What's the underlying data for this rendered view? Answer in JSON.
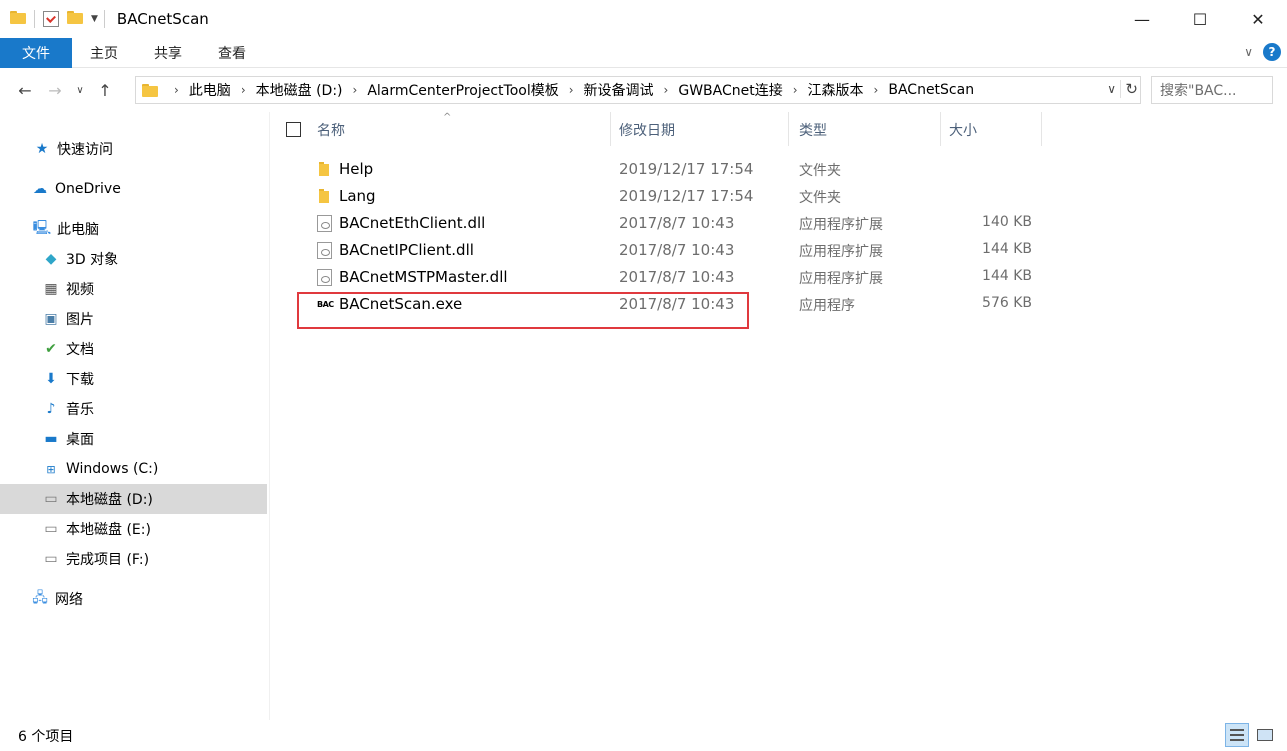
{
  "window": {
    "title": "BACnetScan",
    "controls": {
      "minimize": "—",
      "maximize": "☐",
      "close": "✕"
    }
  },
  "ribbon": {
    "tabs": [
      {
        "label": "文件",
        "active": true
      },
      {
        "label": "主页"
      },
      {
        "label": "共享"
      },
      {
        "label": "查看"
      }
    ],
    "help_label": "?"
  },
  "address": {
    "crumbs": [
      "此电脑",
      "本地磁盘 (D:)",
      "AlarmCenterProjectTool模板",
      "新设备调试",
      "GWBACnet连接",
      "江森版本",
      "BACnetScan"
    ],
    "search_placeholder": "搜索\"BAC..."
  },
  "sidebar": {
    "items": [
      {
        "label": "快速访问",
        "icon": "star-icon"
      },
      {
        "label": "OneDrive",
        "icon": "cloud-icon"
      },
      {
        "label": "此电脑",
        "icon": "pc-icon"
      },
      {
        "label": "3D 对象",
        "icon": "cube-icon"
      },
      {
        "label": "视频",
        "icon": "video-icon"
      },
      {
        "label": "图片",
        "icon": "picture-icon"
      },
      {
        "label": "文档",
        "icon": "document-icon"
      },
      {
        "label": "下载",
        "icon": "download-icon"
      },
      {
        "label": "音乐",
        "icon": "music-icon"
      },
      {
        "label": "桌面",
        "icon": "desktop-icon"
      },
      {
        "label": "Windows (C:)",
        "icon": "windows-drive-icon"
      },
      {
        "label": "本地磁盘 (D:)",
        "icon": "drive-icon",
        "selected": true
      },
      {
        "label": "本地磁盘 (E:)",
        "icon": "drive-icon"
      },
      {
        "label": "完成项目 (F:)",
        "icon": "drive-icon"
      },
      {
        "label": "网络",
        "icon": "network-icon"
      }
    ]
  },
  "columns": {
    "name": "名称",
    "date": "修改日期",
    "type": "类型",
    "size": "大小"
  },
  "files": [
    {
      "name": "Help",
      "date": "2019/12/17 17:54",
      "type": "文件夹",
      "size": "",
      "icon": "folder-icon"
    },
    {
      "name": "Lang",
      "date": "2019/12/17 17:54",
      "type": "文件夹",
      "size": "",
      "icon": "folder-icon"
    },
    {
      "name": "BACnetEthClient.dll",
      "date": "2017/8/7 10:43",
      "type": "应用程序扩展",
      "size": "140 KB",
      "icon": "dll-file-icon"
    },
    {
      "name": "BACnetIPClient.dll",
      "date": "2017/8/7 10:43",
      "type": "应用程序扩展",
      "size": "144 KB",
      "icon": "dll-file-icon"
    },
    {
      "name": "BACnetMSTPMaster.dll",
      "date": "2017/8/7 10:43",
      "type": "应用程序扩展",
      "size": "144 KB",
      "icon": "dll-file-icon"
    },
    {
      "name": "BACnetScan.exe",
      "date": "2017/8/7 10:43",
      "type": "应用程序",
      "size": "576 KB",
      "icon": "exe-icon"
    }
  ],
  "status": {
    "item_count": "6 个项目"
  },
  "colors": {
    "accent": "#1979ca",
    "selected_nav": "#d9d9d9",
    "highlight_box": "#e0393e"
  }
}
